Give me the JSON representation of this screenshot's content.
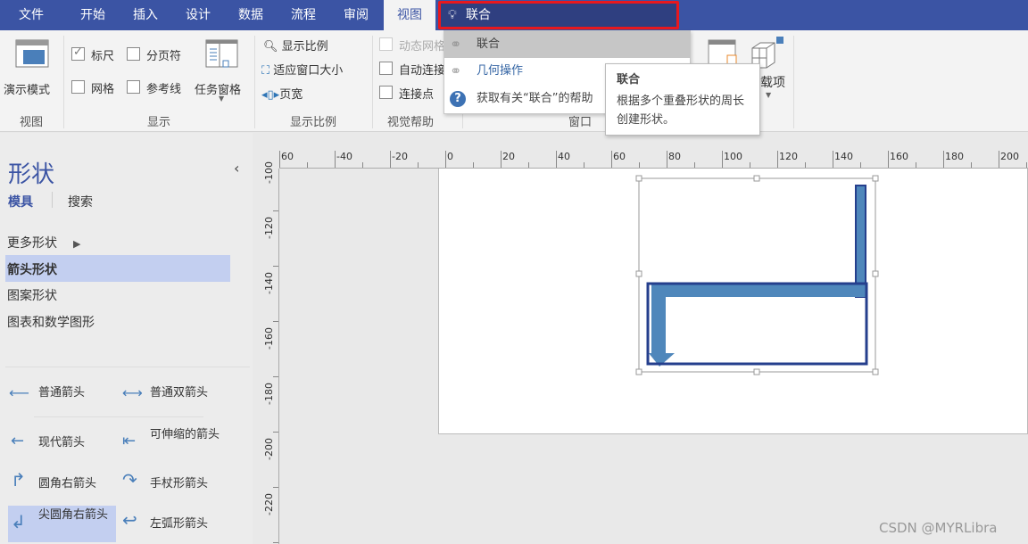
{
  "tabs": [
    "文件",
    "开始",
    "插入",
    "设计",
    "数据",
    "流程",
    "审阅",
    "视图"
  ],
  "active_tab": "视图",
  "search": {
    "value": "联合",
    "icon": "lightbulb-icon"
  },
  "ribbon": {
    "view_group": {
      "label": "视图",
      "presentation_mode": "演示模式"
    },
    "show_group": {
      "label": "显示",
      "ruler": "标尺",
      "ruler_checked": true,
      "page_breaks": "分页符",
      "grid": "网格",
      "guides": "参考线",
      "task_panes": "任务窗格"
    },
    "zoom_group": {
      "label": "显示比例",
      "zoom": "显示比例",
      "fit_window": "适应窗口大小",
      "page_width": "页宽"
    },
    "visual_aids_group": {
      "label": "视觉帮助",
      "dynamic_grid": "动态网格",
      "auto_connect": "自动连接",
      "connection_points": "连接点"
    },
    "window_group": {
      "label": "窗口"
    },
    "addins": "载项"
  },
  "dropdown": {
    "items": [
      "联合",
      "几何操作",
      "获取有关“联合”的帮助"
    ]
  },
  "tooltip": {
    "title": "联合",
    "body": "根据多个重叠形状的周长创建形状。"
  },
  "shapes_panel": {
    "title": "形状",
    "tab_stencils": "模具",
    "tab_search": "搜索",
    "categories": [
      "更多形状",
      "箭头形状",
      "图案形状",
      "图表和数学图形"
    ],
    "selected_category": "箭头形状",
    "shapes": [
      "普通箭头",
      "普通双箭头",
      "现代箭头",
      "可伸缩的箭头",
      "圆角右箭头",
      "手杖形箭头",
      "尖圆角右箭头",
      "左弧形箭头"
    ]
  },
  "hruler_labels": [
    "60",
    "-40",
    "-20",
    "0",
    "20",
    "40",
    "60",
    "80",
    "100",
    "120",
    "140",
    "160",
    "180",
    "200"
  ],
  "vruler_labels": [
    "-100",
    "-120",
    "-140",
    "-160",
    "-180",
    "-200",
    "-220"
  ],
  "colors": {
    "ribbon": "#3b54a4",
    "shape_fill": "#4f87bb",
    "union_outline": "#253f8d",
    "highlight": "#c3cff0"
  },
  "watermark": "CSDN @MYRLibra"
}
